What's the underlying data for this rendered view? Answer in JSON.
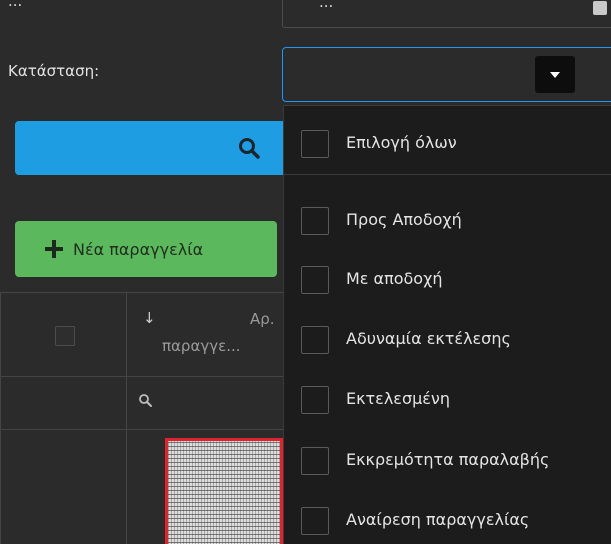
{
  "top_row": {
    "label": "...",
    "value": "..."
  },
  "status": {
    "label": "Κατάσταση:",
    "value": ""
  },
  "search_button": {
    "icon": "search-icon"
  },
  "new_order_button": {
    "label": "Νέα παραγγελία",
    "icon": "plus-icon"
  },
  "grid": {
    "sort_indicator": "↓",
    "order_column_line1": "Αρ.",
    "order_column_line2": "παραγγε...",
    "filter_icon": "search-icon"
  },
  "status_dropdown": {
    "select_all": "Επιλογή όλων",
    "options": [
      "Προς Αποδοχή",
      "Με αποδοχή",
      "Αδυναμία εκτέλεσης",
      "Εκτελεσμένη",
      "Εκκρεμότητα παραλαβής",
      "Αναίρεση παραγγελίας"
    ]
  },
  "colors": {
    "background": "#2b2b2b",
    "search_button": "#1e9de2",
    "new_order_button": "#5cb85c",
    "focus_border": "#2196f3",
    "dropdown_bg": "#1c1c1c",
    "thumbnail_border": "#e0232e"
  }
}
